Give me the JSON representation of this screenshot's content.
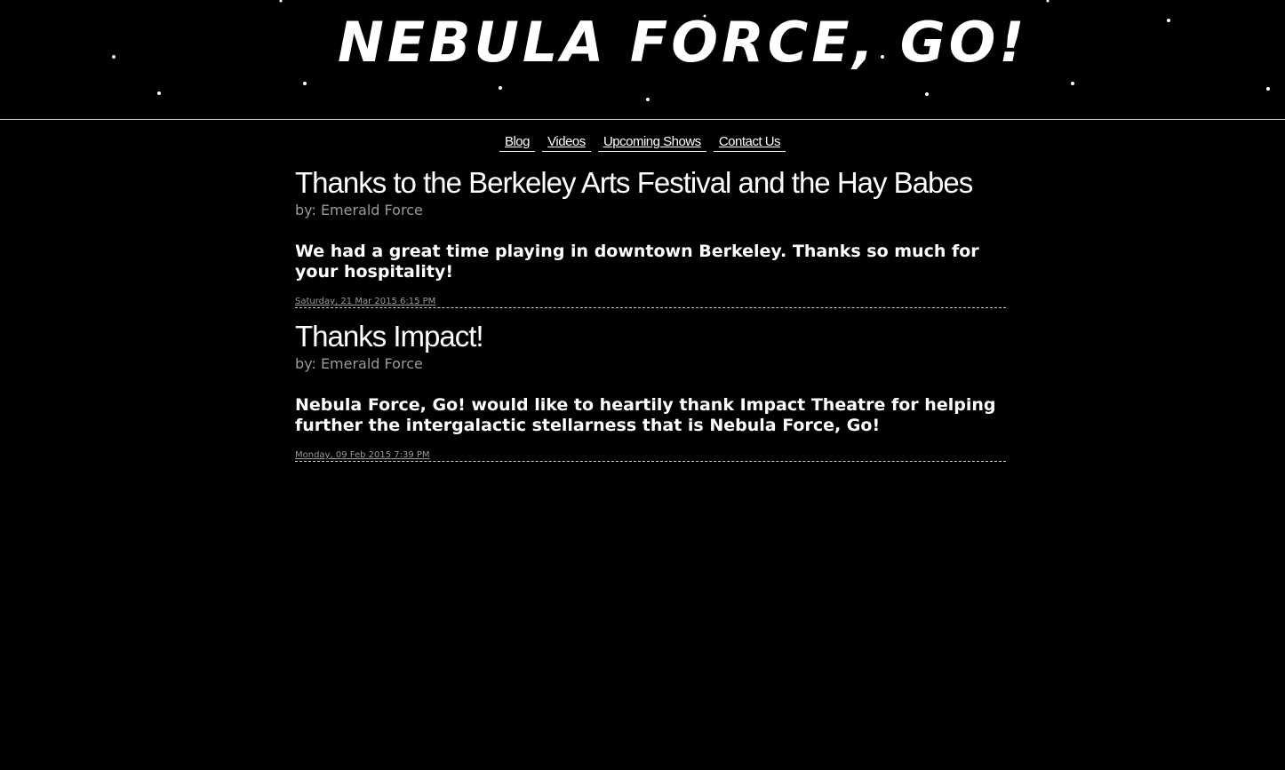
{
  "site": {
    "title": "NEBULA FORCE, GO!"
  },
  "nav": {
    "items": [
      "Blog",
      "Videos",
      "Upcoming Shows",
      "Contact Us"
    ]
  },
  "posts": [
    {
      "title": "Thanks to the Berkeley Arts Festival and the Hay Babes",
      "author": "by: Emerald Force",
      "body": "We had a great time playing in downtown Berkeley. Thanks so much for your hospitality!",
      "date": "Saturday, 21 Mar 2015 6:15 PM"
    },
    {
      "title": "Thanks Impact!",
      "author": "by: Emerald Force",
      "body": "Nebula Force, Go! would like to heartily thank Impact Theatre for helping further the intergalactic stellarness that is Nebula Force, Go!",
      "date": "Monday, 09 Feb 2015 7:39 PM"
    }
  ],
  "colors": {
    "background": "#000000",
    "laser_red": "#ff2020",
    "laser_blue": "#3050ff",
    "laser_yellow": "#f5e000",
    "laser_orange": "#ff9020",
    "laser_green": "#20e020",
    "laser_purple": "#b050ff"
  }
}
